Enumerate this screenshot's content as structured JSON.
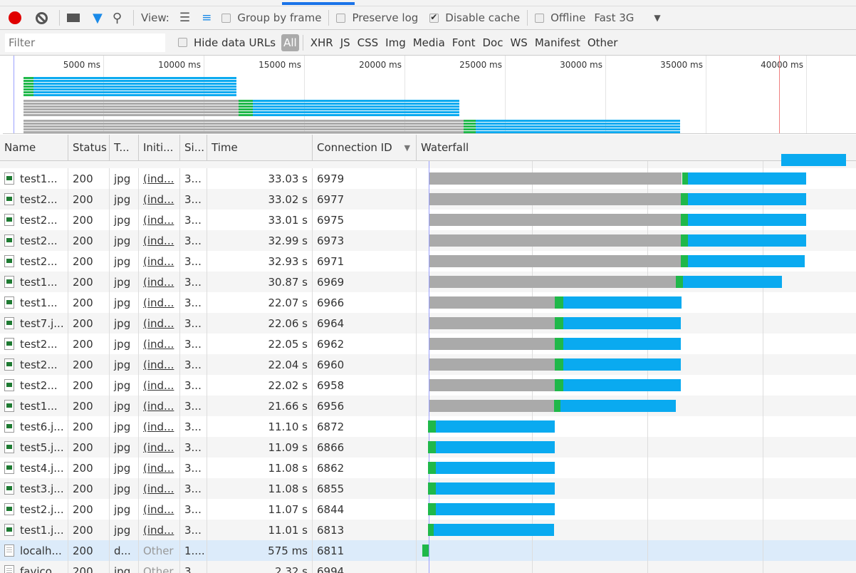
{
  "toolbar": {
    "view_label": "View:",
    "group_by_frame": "Group by frame",
    "preserve_log": "Preserve log",
    "disable_cache": "Disable cache",
    "offline": "Offline",
    "throttle": "Fast 3G",
    "disable_cache_checked": true,
    "record_color": "#e00000"
  },
  "filterbar": {
    "placeholder": "Filter",
    "hide_data_urls": "Hide data URLs",
    "types": [
      "All",
      "XHR",
      "JS",
      "CSS",
      "Img",
      "Media",
      "Font",
      "Doc",
      "WS",
      "Manifest",
      "Other"
    ]
  },
  "overview": {
    "ticks": [
      "5000 ms",
      "10000 ms",
      "15000 ms",
      "20000 ms",
      "25000 ms",
      "30000 ms",
      "35000 ms",
      "40000 ms"
    ]
  },
  "columns": {
    "name": "Name",
    "status": "Status",
    "type": "T...",
    "initiator": "Initi...",
    "size": "Si...",
    "time": "Time",
    "connection": "Connection ID",
    "waterfall": "Waterfall"
  },
  "colors": {
    "waiting": "#aaaaaa",
    "connect": "#1fb84a",
    "download": "#0aaaf0"
  },
  "rows": [
    {
      "name": "test1...",
      "status": "200",
      "type": "jpg",
      "initiator": "(ind...",
      "size": "3...",
      "time": "33.03 s",
      "conn": "6979",
      "timing": [
        0.6,
        22.5,
        23.0,
        33.3
      ]
    },
    {
      "name": "test2...",
      "status": "200",
      "type": "jpg",
      "initiator": "(ind...",
      "size": "3...",
      "time": "33.02 s",
      "conn": "6977",
      "timing": [
        0.6,
        22.4,
        23.0,
        33.3
      ]
    },
    {
      "name": "test2...",
      "status": "200",
      "type": "jpg",
      "initiator": "(ind...",
      "size": "3...",
      "time": "33.01 s",
      "conn": "6975",
      "timing": [
        0.6,
        22.4,
        23.0,
        33.3
      ]
    },
    {
      "name": "test2...",
      "status": "200",
      "type": "jpg",
      "initiator": "(ind...",
      "size": "3...",
      "time": "32.99 s",
      "conn": "6973",
      "timing": [
        0.6,
        22.4,
        23.0,
        33.3
      ]
    },
    {
      "name": "test2...",
      "status": "200",
      "type": "jpg",
      "initiator": "(ind...",
      "size": "3...",
      "time": "32.93 s",
      "conn": "6971",
      "timing": [
        0.6,
        22.4,
        23.0,
        33.15
      ]
    },
    {
      "name": "test1...",
      "status": "200",
      "type": "jpg",
      "initiator": "(ind...",
      "size": "3...",
      "time": "30.87 s",
      "conn": "6969",
      "timing": [
        0.6,
        22.0,
        22.6,
        31.2
      ]
    },
    {
      "name": "test1...",
      "status": "200",
      "type": "jpg",
      "initiator": "(ind...",
      "size": "3...",
      "time": "22.07 s",
      "conn": "6966",
      "timing": [
        0.6,
        11.5,
        12.2,
        22.5
      ]
    },
    {
      "name": "test7.j...",
      "status": "200",
      "type": "jpg",
      "initiator": "(ind...",
      "size": "3...",
      "time": "22.06 s",
      "conn": "6964",
      "timing": [
        0.6,
        11.5,
        12.2,
        22.4
      ]
    },
    {
      "name": "test2...",
      "status": "200",
      "type": "jpg",
      "initiator": "(ind...",
      "size": "3...",
      "time": "22.05 s",
      "conn": "6962",
      "timing": [
        0.6,
        11.5,
        12.2,
        22.4
      ]
    },
    {
      "name": "test2...",
      "status": "200",
      "type": "jpg",
      "initiator": "(ind...",
      "size": "3...",
      "time": "22.04 s",
      "conn": "6960",
      "timing": [
        0.6,
        11.5,
        12.2,
        22.4
      ]
    },
    {
      "name": "test2...",
      "status": "200",
      "type": "jpg",
      "initiator": "(ind...",
      "size": "3...",
      "time": "22.02 s",
      "conn": "6958",
      "timing": [
        0.6,
        11.5,
        12.2,
        22.4
      ]
    },
    {
      "name": "test1...",
      "status": "200",
      "type": "jpg",
      "initiator": "(ind...",
      "size": "3...",
      "time": "21.66 s",
      "conn": "6956",
      "timing": [
        0.6,
        11.4,
        12.0,
        22.0
      ]
    },
    {
      "name": "test6.j...",
      "status": "200",
      "type": "jpg",
      "initiator": "(ind...",
      "size": "3...",
      "time": "11.10 s",
      "conn": "6872",
      "timing": [
        0.5,
        0.5,
        1.2,
        11.5
      ]
    },
    {
      "name": "test5.j...",
      "status": "200",
      "type": "jpg",
      "initiator": "(ind...",
      "size": "3...",
      "time": "11.09 s",
      "conn": "6866",
      "timing": [
        0.5,
        0.5,
        1.2,
        11.5
      ]
    },
    {
      "name": "test4.j...",
      "status": "200",
      "type": "jpg",
      "initiator": "(ind...",
      "size": "3...",
      "time": "11.08 s",
      "conn": "6862",
      "timing": [
        0.5,
        0.5,
        1.2,
        11.5
      ]
    },
    {
      "name": "test3.j...",
      "status": "200",
      "type": "jpg",
      "initiator": "(ind...",
      "size": "3...",
      "time": "11.08 s",
      "conn": "6855",
      "timing": [
        0.5,
        0.5,
        1.2,
        11.5
      ]
    },
    {
      "name": "test2.j...",
      "status": "200",
      "type": "jpg",
      "initiator": "(ind...",
      "size": "3...",
      "time": "11.07 s",
      "conn": "6844",
      "timing": [
        0.5,
        0.5,
        1.2,
        11.5
      ]
    },
    {
      "name": "test1.j...",
      "status": "200",
      "type": "jpg",
      "initiator": "(ind...",
      "size": "3...",
      "time": "11.01 s",
      "conn": "6813",
      "timing": [
        0.5,
        0.5,
        1.0,
        11.4
      ]
    },
    {
      "name": "localh...",
      "status": "200",
      "type": "d...",
      "initiator": "Other",
      "size": "1....",
      "time": "575 ms",
      "conn": "6811",
      "timing": [
        0,
        0,
        0.55,
        0.55
      ],
      "doc": true,
      "selected": true
    },
    {
      "name": "favico",
      "status": "200",
      "type": "jpg",
      "initiator": "Other",
      "size": "3...",
      "time": "2.32 s",
      "conn": "6994",
      "timing": null,
      "doc": true
    }
  ]
}
